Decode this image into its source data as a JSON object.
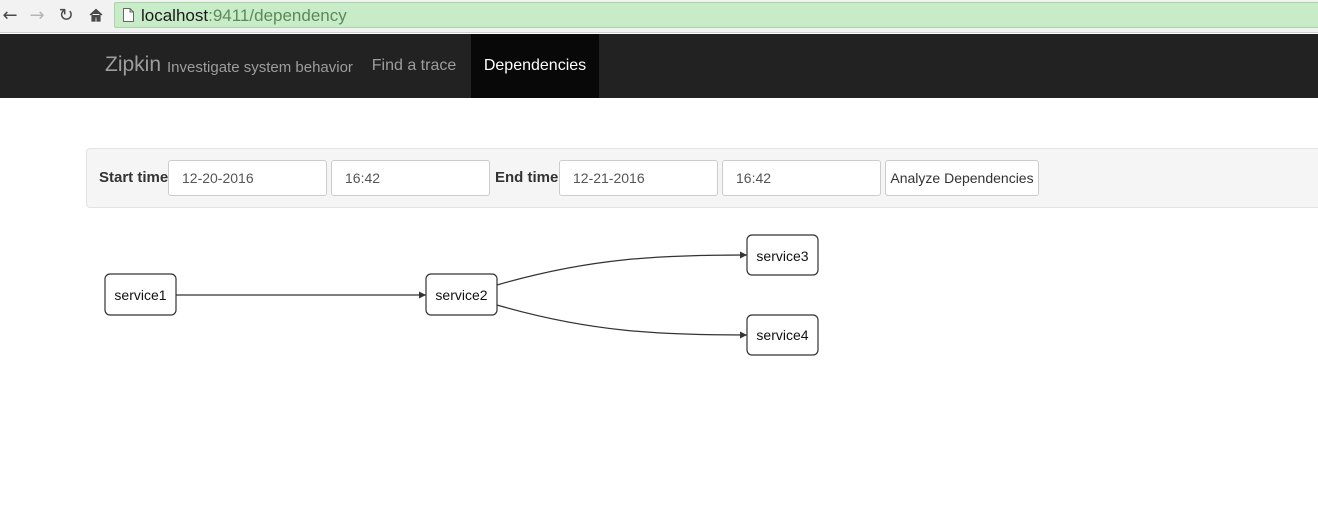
{
  "browser": {
    "url_host": "localhost",
    "url_rest": ":9411/dependency"
  },
  "navbar": {
    "brand": "Zipkin",
    "tagline": "Investigate system behavior",
    "tabs": [
      {
        "label": "Find a trace",
        "active": false
      },
      {
        "label": "Dependencies",
        "active": true
      }
    ]
  },
  "filters": {
    "start_label": "Start time",
    "start_date": "12-20-2016",
    "start_time": "16:42",
    "end_label": "End time",
    "end_date": "12-21-2016",
    "end_time": "16:42",
    "analyze_label": "Analyze Dependencies"
  },
  "graph": {
    "nodes": [
      {
        "id": "service1",
        "label": "service1"
      },
      {
        "id": "service2",
        "label": "service2"
      },
      {
        "id": "service3",
        "label": "service3"
      },
      {
        "id": "service4",
        "label": "service4"
      }
    ],
    "edges": [
      {
        "from": "service1",
        "to": "service2"
      },
      {
        "from": "service2",
        "to": "service3"
      },
      {
        "from": "service2",
        "to": "service4"
      }
    ]
  }
}
